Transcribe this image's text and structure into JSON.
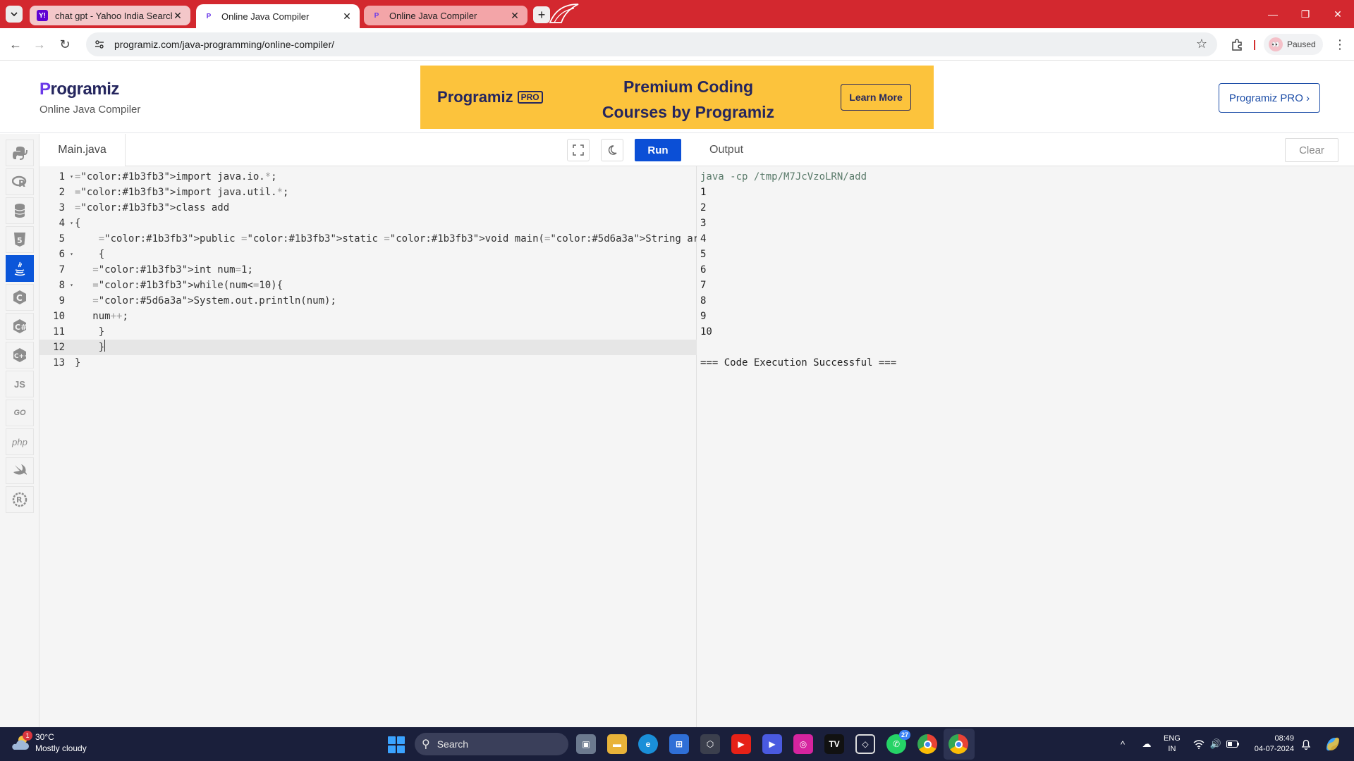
{
  "browser": {
    "tabs": [
      {
        "title": "chat gpt - Yahoo India Search R",
        "favicon": "yahoo-favicon"
      },
      {
        "title": "Online Java Compiler",
        "favicon": "programiz-favicon"
      },
      {
        "title": "Online Java Compiler",
        "favicon": "programiz-favicon"
      }
    ],
    "url": "programiz.com/java-programming/online-compiler/",
    "profile_status": "Paused"
  },
  "site": {
    "brand": "rogramiz",
    "brand_initial": "P",
    "subtitle": "Online Java Compiler",
    "promo": {
      "logo_text": "rogramiz",
      "logo_initial": "P",
      "logo_tag": "PRO",
      "headline_line1": "Premium Coding",
      "headline_line2": "Courses by Programiz",
      "cta": "Learn More"
    },
    "pro_button": "Programiz PRO ›",
    "accent_color": "#0b56d9",
    "promo_color": "#fcc33c"
  },
  "languages": [
    {
      "name": "python",
      "label": "",
      "icon": "python-icon"
    },
    {
      "name": "r",
      "label": "R",
      "icon": "r-icon"
    },
    {
      "name": "sql",
      "label": "",
      "icon": "database-icon"
    },
    {
      "name": "html",
      "label": "5",
      "icon": "html5-icon"
    },
    {
      "name": "java",
      "label": "",
      "icon": "java-icon",
      "active": true
    },
    {
      "name": "c",
      "label": "C",
      "icon": "c-icon"
    },
    {
      "name": "csharp",
      "label": "C",
      "icon": "csharp-icon"
    },
    {
      "name": "cpp",
      "label": "C",
      "icon": "cpp-icon"
    },
    {
      "name": "js",
      "label": "JS",
      "icon": "javascript-icon"
    },
    {
      "name": "go",
      "label": "GO",
      "icon": "go-icon"
    },
    {
      "name": "php",
      "label": "php",
      "icon": "php-icon"
    },
    {
      "name": "swift",
      "label": "",
      "icon": "swift-icon"
    },
    {
      "name": "rust",
      "label": "R",
      "icon": "rust-icon"
    }
  ],
  "editor": {
    "file_name": "Main.java",
    "run_label": "Run",
    "lines": [
      {
        "num": "1",
        "text": "import java.io.*;",
        "fold": true
      },
      {
        "num": "2",
        "text": "import java.util.*;",
        "fold": false
      },
      {
        "num": "3",
        "text": "class add",
        "fold": false
      },
      {
        "num": "4",
        "text": "{",
        "fold": true
      },
      {
        "num": "5",
        "text": "    public static void main(String args[])",
        "fold": false
      },
      {
        "num": "6",
        "text": "    {",
        "fold": true
      },
      {
        "num": "7",
        "text": "   int num=1;",
        "fold": false
      },
      {
        "num": "8",
        "text": "   while(num<=10){",
        "fold": true
      },
      {
        "num": "9",
        "text": "   System.out.println(num);",
        "fold": false
      },
      {
        "num": "10",
        "text": "   num++;",
        "fold": false
      },
      {
        "num": "11",
        "text": "    }",
        "fold": false
      },
      {
        "num": "12",
        "text": "    }",
        "fold": false,
        "active": true
      },
      {
        "num": "13",
        "text": "}",
        "fold": false
      }
    ]
  },
  "output": {
    "title": "Output",
    "clear_label": "Clear",
    "lines": [
      "java -cp /tmp/M7JcVzoLRN/add",
      "1",
      "2",
      "3",
      "4",
      "5",
      "6",
      "7",
      "8",
      "9",
      "10",
      "",
      "=== Code Execution Successful ==="
    ]
  },
  "taskbar": {
    "weather_temp": "30°C",
    "weather_desc": "Mostly cloudy",
    "weather_badge": "1",
    "search_label": "Search",
    "whatsapp_count": "27",
    "lang_line1": "ENG",
    "lang_line2": "IN",
    "time": "08:49",
    "date": "04-07-2024"
  }
}
